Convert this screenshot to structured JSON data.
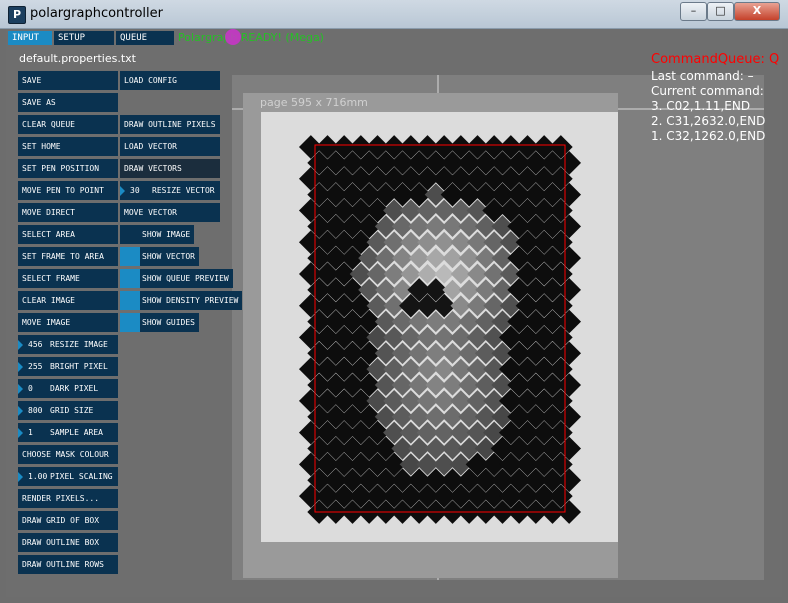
{
  "window": {
    "title": "polargraphcontroller",
    "icon_letter": "P",
    "controls": {
      "minimize": "–",
      "maximize": "□",
      "close": "X"
    }
  },
  "tabs": [
    {
      "label": "INPUT",
      "active": true
    },
    {
      "label": "SETUP",
      "active": false
    },
    {
      "label": "QUEUE",
      "active": false
    }
  ],
  "status_text": "Polargraph READY! (Mega)",
  "properties_file": "default.properties.txt",
  "left_buttons": [
    {
      "label": "SAVE"
    },
    {
      "label": "SAVE AS"
    },
    {
      "label": "CLEAR QUEUE"
    },
    {
      "label": "SET HOME"
    },
    {
      "label": "SET PEN POSITION"
    },
    {
      "label": "MOVE PEN TO POINT"
    },
    {
      "label": "MOVE DIRECT"
    },
    {
      "label": "SELECT AREA"
    },
    {
      "label": "SET FRAME TO AREA"
    },
    {
      "label": "SELECT FRAME"
    },
    {
      "label": "CLEAR IMAGE"
    },
    {
      "label": "MOVE IMAGE"
    },
    {
      "value": "456",
      "label": "RESIZE IMAGE"
    },
    {
      "value": "255",
      "label": "BRIGHT PIXEL"
    },
    {
      "value": "0",
      "label": "DARK PIXEL"
    },
    {
      "value": "800",
      "label": "GRID SIZE"
    },
    {
      "value": "1",
      "label": "SAMPLE AREA"
    },
    {
      "label": "CHOOSE MASK COLOUR"
    },
    {
      "value": "1.00",
      "label": "PIXEL SCALING"
    },
    {
      "label": "RENDER PIXELS..."
    },
    {
      "label": "DRAW GRID OF BOX"
    },
    {
      "label": "DRAW OUTLINE BOX"
    },
    {
      "label": "DRAW OUTLINE ROWS"
    }
  ],
  "right_buttons": {
    "load_config": "LOAD CONFIG",
    "draw_outline_pixels": "DRAW OUTLINE PIXELS",
    "load_vector": "LOAD VECTOR",
    "draw_vectors": "DRAW VECTORS",
    "resize_vector_value": "30",
    "resize_vector": "RESIZE VECTOR",
    "move_vector": "MOVE VECTOR"
  },
  "toggles": [
    {
      "label": "SHOW IMAGE",
      "on": false
    },
    {
      "label": "SHOW VECTOR",
      "on": true
    },
    {
      "label": "SHOW QUEUE PREVIEW",
      "on": true
    },
    {
      "label": "SHOW DENSITY PREVIEW",
      "on": true
    },
    {
      "label": "SHOW GUIDES",
      "on": true
    }
  ],
  "canvas": {
    "page_label": "page 595 x 716mm"
  },
  "command_queue": {
    "title": "CommandQueue: Q",
    "last_command": "Last command: –",
    "current_command": "Current command:",
    "items": [
      "3. C02,1.11,END",
      "2. C31,2632.0,END",
      "1. C32,1262.0,END"
    ]
  },
  "colors": {
    "button_bg": "#0a3250",
    "accent": "#1b8bc4",
    "status_green": "#26c026",
    "queue_red": "#ff0000"
  }
}
